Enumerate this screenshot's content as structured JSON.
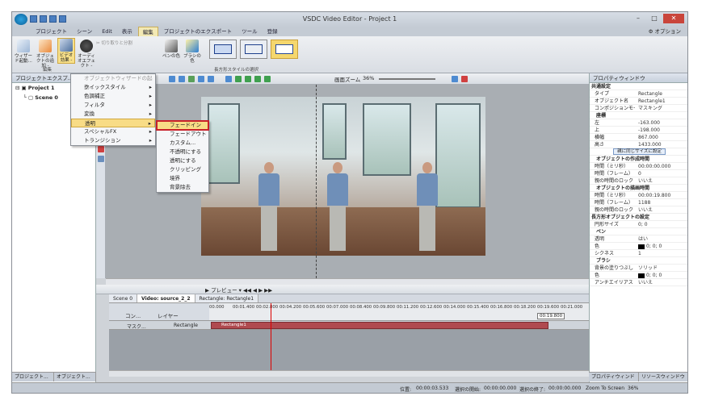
{
  "window": {
    "title": "VSDC Video Editor - Project 1"
  },
  "menubar": {
    "items": [
      "プロジェクト",
      "シーン",
      "Edit",
      "表示",
      "編集",
      "プロジェクトのエクスポート",
      "ツール",
      "登録"
    ],
    "active_index": 4,
    "options_label": "オプション"
  },
  "ribbon": {
    "wizard": "ウィザード起動...",
    "add_object": "オブジェクトの追加 -",
    "video_effects": "ビデオ効果 -",
    "audio_effects": "オーディオエフェクト -",
    "cut_split": "切り取りと分割",
    "pen_color": "ペンの色",
    "brush_color": "ブラシの色",
    "edit_group_label": "編集",
    "rect_style_label": "長方形スタイルの選択"
  },
  "left_panel": {
    "title": "プロジェクトエクスプ...",
    "tree": [
      "Project 1",
      "Scene 0"
    ],
    "tabs": [
      "プロジェクト...",
      "オブジェクト..."
    ]
  },
  "toolbar": {
    "zoom_label": "画面ズーム",
    "zoom_value": "36%"
  },
  "effects_menu": {
    "items": [
      {
        "label": "オブジェクトウィザードの起動...",
        "disabled": true,
        "submenu": false
      },
      {
        "label": "クイックスタイル",
        "disabled": false,
        "submenu": true
      },
      {
        "label": "色調補正",
        "disabled": false,
        "submenu": true
      },
      {
        "label": "フィルタ",
        "disabled": false,
        "submenu": true
      },
      {
        "label": "変換",
        "disabled": false,
        "submenu": true
      },
      {
        "label": "透明",
        "disabled": false,
        "submenu": true
      },
      {
        "label": "スペシャルFX",
        "disabled": false,
        "submenu": true
      },
      {
        "label": "トランジション",
        "disabled": false,
        "submenu": true
      }
    ],
    "highlighted_index": 5
  },
  "transparency_submenu": {
    "items": [
      "フェードイン",
      "フェードアウト",
      "カスタム...",
      "不透明にする",
      "透明にする",
      "クリッピング",
      "境界",
      "背景除去"
    ],
    "highlighted_index": 0
  },
  "timeline": {
    "toolbar_preview": "プレビュー",
    "tabs": [
      "Scene 0",
      "Video: source_2_2",
      "Rectangle: Rectangle1"
    ],
    "current_tab": 1,
    "header_labels": [
      "コン...",
      "レイヤー"
    ],
    "ruler": [
      "00.000",
      "00:01.400",
      "00:02.800",
      "00:04.200",
      "00:05.600",
      "00:07.000",
      "00:08.400",
      "00:09.800",
      "00:11.200",
      "00:12.600",
      "00:14.000",
      "00:15.400",
      "00:16.800",
      "00:18.200",
      "00:19.600",
      "00:21.000"
    ],
    "end_time": "00:19.800",
    "track": {
      "blend": "マスク...",
      "name": "Rectangle",
      "clip": "Rectangle1"
    }
  },
  "properties": {
    "title": "プロパティウィンドウ",
    "rows": [
      {
        "type": "sec",
        "k": "共通設定"
      },
      {
        "type": "row",
        "k": "タイプ",
        "v": "Rectangle"
      },
      {
        "type": "row",
        "k": "オブジェクト名",
        "v": "Rectangle1"
      },
      {
        "type": "row",
        "k": "コンポジションモード",
        "v": "マスキング"
      },
      {
        "type": "sub",
        "k": "座標"
      },
      {
        "type": "row",
        "k": "左",
        "v": "-163.000"
      },
      {
        "type": "row",
        "k": "上",
        "v": "-198.000"
      },
      {
        "type": "row",
        "k": "横幅",
        "v": "867.000"
      },
      {
        "type": "row",
        "k": "高さ",
        "v": "1433.000"
      },
      {
        "type": "btn",
        "k": "親に同じサイズに設定"
      },
      {
        "type": "sub",
        "k": "オブジェクトの作成時間"
      },
      {
        "type": "row",
        "k": "時間（ミリ秒）",
        "v": "00:00:00.000"
      },
      {
        "type": "row",
        "k": "時間（フレーム）",
        "v": "0"
      },
      {
        "type": "row",
        "k": "親の時間のロック",
        "v": "いいえ"
      },
      {
        "type": "sub",
        "k": "オブジェクトの描画時間"
      },
      {
        "type": "row",
        "k": "時間（ミリ秒）",
        "v": "00:00:19.800"
      },
      {
        "type": "row",
        "k": "時間（フレーム）",
        "v": "1188"
      },
      {
        "type": "row",
        "k": "親の時間のロック",
        "v": "いいえ"
      },
      {
        "type": "sec",
        "k": "長方形オブジェクトの設定"
      },
      {
        "type": "row",
        "k": "円形サイズ",
        "v": "0; 0"
      },
      {
        "type": "sub",
        "k": "ペン"
      },
      {
        "type": "row",
        "k": "透明",
        "v": "はい"
      },
      {
        "type": "color",
        "k": "色",
        "v": "0; 0; 0"
      },
      {
        "type": "row",
        "k": "シクネス",
        "v": "1"
      },
      {
        "type": "sub",
        "k": "ブラシ"
      },
      {
        "type": "row",
        "k": "背景の塗りつぶし",
        "v": "ソリッド"
      },
      {
        "type": "color",
        "k": "色",
        "v": "0; 0; 0"
      },
      {
        "type": "row",
        "k": "アンチエイリアス",
        "v": "いいえ"
      }
    ],
    "tabs": [
      "プロパティウィンドウ",
      "リソースウィンドウ"
    ]
  },
  "status": {
    "position_label": "位置:",
    "position": "00:00:03.533",
    "sel_start_label": "選択の開始:",
    "sel_start": "00:00:00.000",
    "sel_end_label": "選択の終了:",
    "sel_end": "00:00:00.000",
    "zoom_label": "Zoom To Screen",
    "zoom": "36%"
  },
  "colors": {
    "accent": "#f8dc86",
    "highlight_box": "#c8202a",
    "clip": "#b04a4f"
  }
}
